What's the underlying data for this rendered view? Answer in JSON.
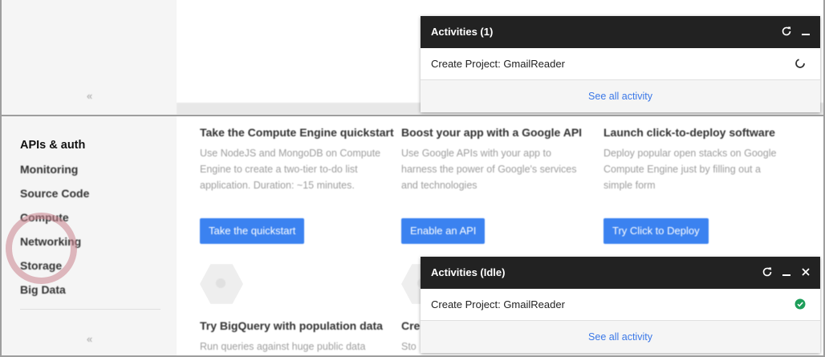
{
  "sidebar": {
    "collapse_glyph": "«",
    "items": [
      {
        "label": "APIs & auth",
        "active": true
      },
      {
        "label": "Monitoring"
      },
      {
        "label": "Source Code"
      },
      {
        "label": "Compute"
      },
      {
        "label": "Networking"
      },
      {
        "label": "Storage"
      },
      {
        "label": "Big Data"
      }
    ]
  },
  "cards": [
    {
      "title": "Take the Compute Engine quickstart",
      "desc": "Use NodeJS and MongoDB on Compute Engine to create a two-tier to-do list application. Duration: ~15 minutes.",
      "button": "Take the quickstart"
    },
    {
      "title": "Boost your app with a Google API",
      "desc": "Use Google APIs with your app to harness the power of Google's services and technologies",
      "button": "Enable an API"
    },
    {
      "title": "Launch click-to-deploy software",
      "desc": "Deploy popular open stacks on Google Compute Engine just by filling out a simple form",
      "button": "Try Click to Deploy"
    }
  ],
  "lower_cards": [
    {
      "title": "Try BigQuery with population data",
      "desc": "Run queries against huge public data"
    },
    {
      "title": "Cre",
      "desc": "Sto"
    }
  ],
  "activity_running": {
    "title": "Activities (1)",
    "item": "Create Project: GmailReader",
    "status": "in-progress",
    "status_icon": "spinner-icon",
    "link": "See all activity"
  },
  "activity_idle": {
    "title": "Activities (Idle)",
    "item": "Create Project: GmailReader",
    "status": "complete",
    "status_icon": "check-circle-icon",
    "link": "See all activity"
  },
  "colors": {
    "accent_blue": "#3b82f0",
    "link_blue": "#3b78e7",
    "panel_header": "#222222",
    "success_green": "#1e9e5a",
    "highlight_ring": "#c9828c"
  }
}
